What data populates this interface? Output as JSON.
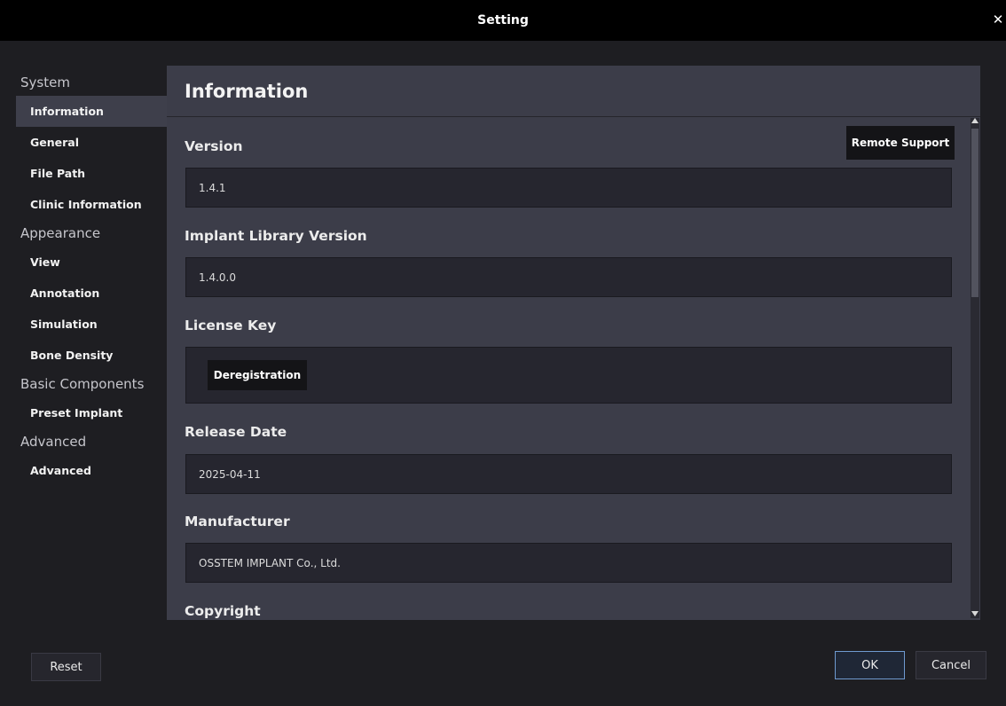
{
  "window": {
    "title": "Setting",
    "close_icon": "close-icon"
  },
  "sidebar": {
    "system": "System",
    "information": "Information",
    "general": "General",
    "file_path": "File Path",
    "clinic_information": "Clinic Information",
    "appearance": "Appearance",
    "view": "View",
    "annotation": "Annotation",
    "simulation": "Simulation",
    "bone_density": "Bone Density",
    "basic_components": "Basic Components",
    "preset_implant": "Preset Implant",
    "advanced_cat": "Advanced",
    "advanced": "Advanced"
  },
  "panel": {
    "title": "Information",
    "remote_support": "Remote Support",
    "version_label": "Version",
    "version_value": "1.4.1",
    "implant_label": "Implant Library Version",
    "implant_value": "1.4.0.0",
    "license_label": "License Key",
    "deregistration": "Deregistration",
    "release_label": "Release Date",
    "release_value": "2025-04-11",
    "manufacturer_label": "Manufacturer",
    "manufacturer_value": "OSSTEM IMPLANT Co., Ltd.",
    "copyright_label": "Copyright"
  },
  "footer": {
    "reset": "Reset",
    "ok": "OK",
    "cancel": "Cancel"
  },
  "colors": {
    "panel": "#3c3d49",
    "field": "#26262f",
    "accent": "#6f9ad0"
  }
}
